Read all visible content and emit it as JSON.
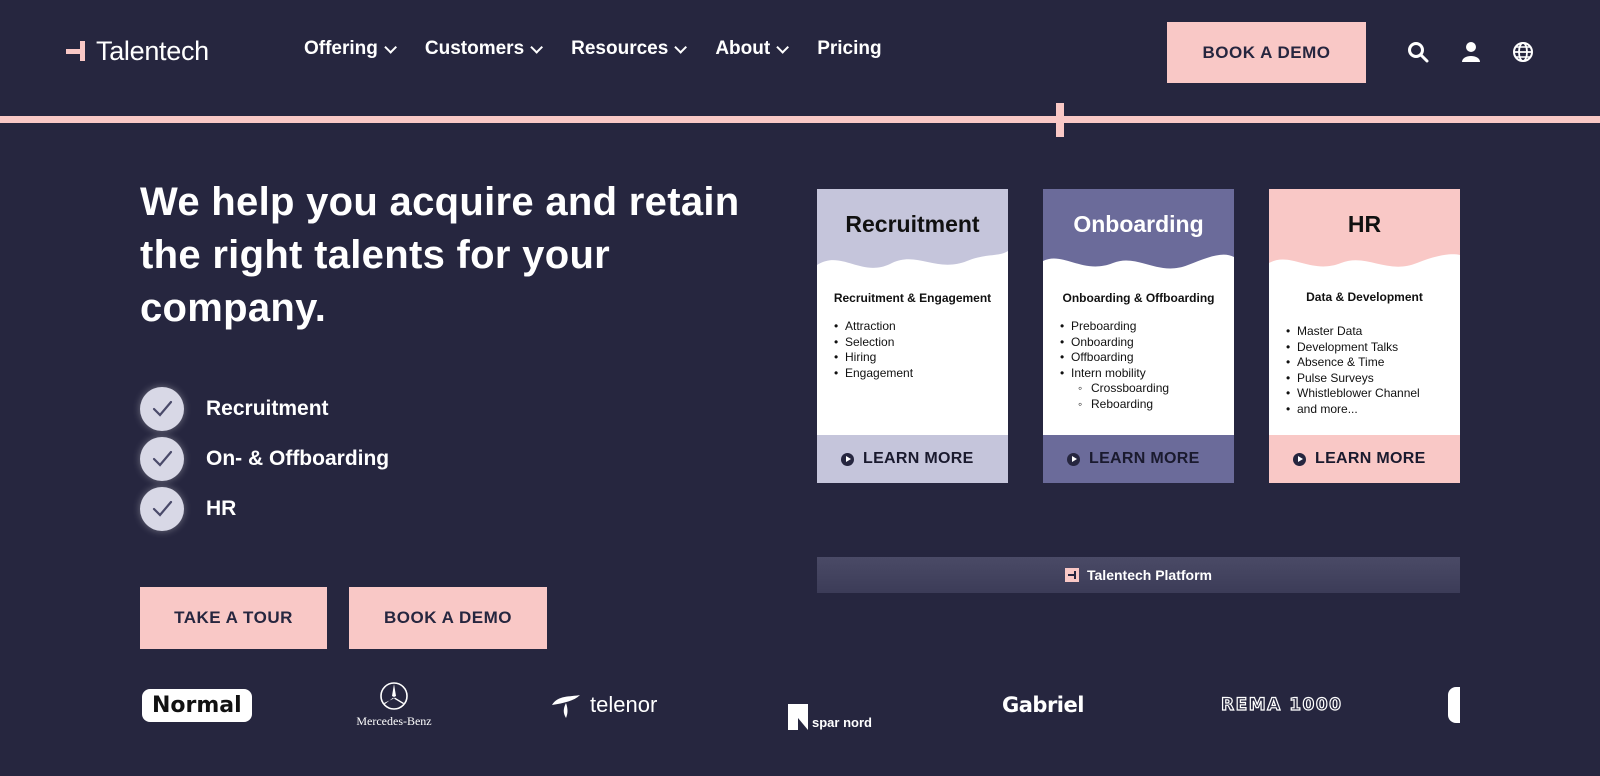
{
  "header": {
    "logo_text": "Talentech",
    "nav": [
      {
        "label": "Offering",
        "has_dropdown": true
      },
      {
        "label": "Customers",
        "has_dropdown": true
      },
      {
        "label": "Resources",
        "has_dropdown": true
      },
      {
        "label": "About",
        "has_dropdown": true
      },
      {
        "label": "Pricing",
        "has_dropdown": false
      }
    ],
    "demo_button": "BOOK A DEMO",
    "icons": [
      "search-icon",
      "user-icon",
      "globe-icon"
    ]
  },
  "hero": {
    "title": "We help you acquire and retain the right talents for your company.",
    "checklist": [
      "Recruitment",
      "On- & Offboarding",
      "HR"
    ],
    "tour_button": "TAKE A TOUR",
    "demo_button": "BOOK A DEMO"
  },
  "cards": [
    {
      "title": "Recruitment",
      "subtitle": "Recruitment & Engagement",
      "items": [
        "Attraction",
        "Selection",
        "Hiring",
        "Engagement"
      ],
      "subitems": [],
      "cta": "LEARN MORE",
      "top_color": "#c5c5db",
      "title_color": "#111111",
      "foot_color": "#c5c5db"
    },
    {
      "title": "Onboarding",
      "subtitle": "Onboarding & Offboarding",
      "items": [
        "Preboarding",
        "Onboarding",
        "Offboarding",
        "Intern mobility"
      ],
      "subitems": [
        "Crossboarding",
        "Reboarding"
      ],
      "cta": "LEARN  MORE",
      "top_color": "#6b6b9a",
      "title_color": "#ffffff",
      "foot_color": "#6b6b9a"
    },
    {
      "title": "HR",
      "subtitle": "Data & Development",
      "items": [
        "Master Data",
        "Development Talks",
        "Absence & Time",
        "Pulse Surveys",
        "Whistleblower Channel",
        "and more..."
      ],
      "subitems": [],
      "cta": "LEARN MORE",
      "top_color": "#f9c8c6",
      "title_color": "#111111",
      "foot_color": "#f9c8c6"
    }
  ],
  "platform_label": "Talentech Platform",
  "customer_logos": [
    "Normal",
    "Mercedes-Benz",
    "telenor",
    "spar nord",
    "Gabriel",
    "REMA 1000"
  ],
  "colors": {
    "background": "#26263f",
    "accent_pink": "#f9c8c6",
    "lavender": "#c5c5db",
    "purple": "#6b6b9a"
  }
}
